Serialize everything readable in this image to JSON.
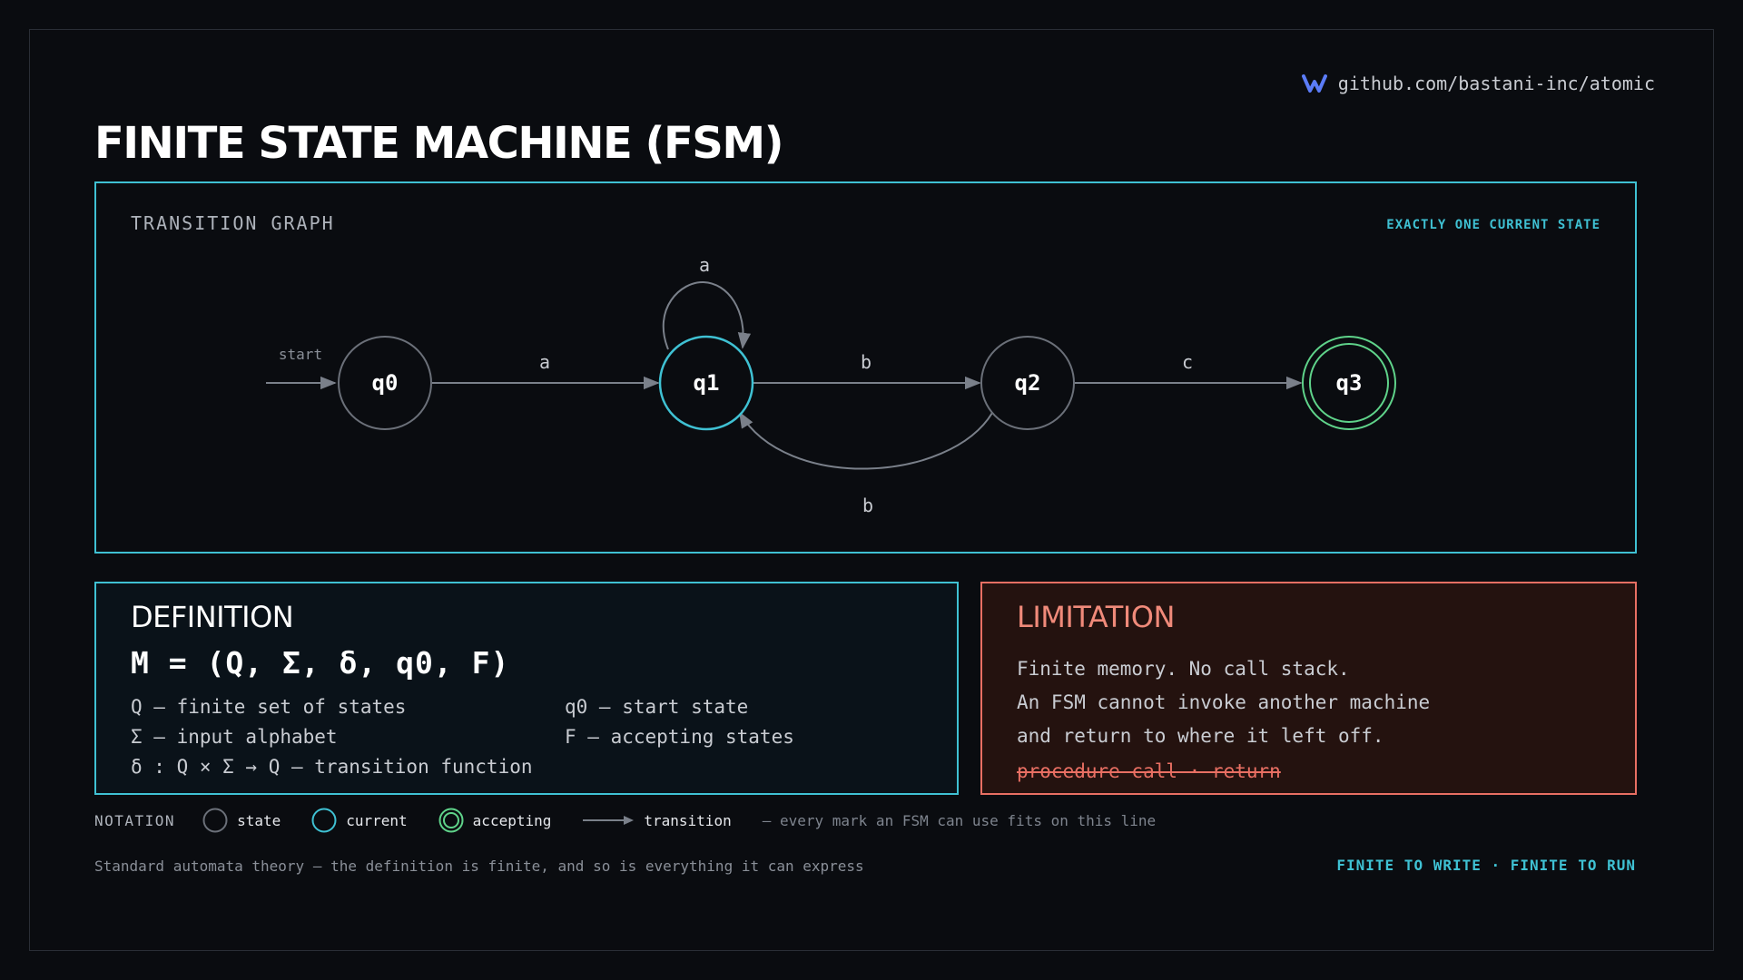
{
  "repo": {
    "text": "github.com/bastani-inc/atomic",
    "logo_icon": "atomic-v-logo-icon"
  },
  "title": "FINITE STATE MACHINE (FSM)",
  "graph": {
    "label": "TRANSITION GRAPH",
    "badge": "EXACTLY ONE CURRENT STATE",
    "start_label": "start",
    "states": [
      {
        "id": "q0",
        "label": "q0",
        "kind": "state"
      },
      {
        "id": "q1",
        "label": "q1",
        "kind": "current"
      },
      {
        "id": "q2",
        "label": "q2",
        "kind": "state"
      },
      {
        "id": "q3",
        "label": "q3",
        "kind": "accepting"
      }
    ],
    "transitions": [
      {
        "from": "q0",
        "to": "q1",
        "symbol": "a"
      },
      {
        "from": "q1",
        "to": "q1",
        "symbol": "a"
      },
      {
        "from": "q1",
        "to": "q2",
        "symbol": "b"
      },
      {
        "from": "q2",
        "to": "q1",
        "symbol": "b"
      },
      {
        "from": "q2",
        "to": "q3",
        "symbol": "c"
      }
    ]
  },
  "definition": {
    "heading": "DEFINITION",
    "formula": "M = (Q, Σ, δ, q0, F)",
    "items": [
      "Q — finite set of states",
      "Σ — input alphabet",
      "δ : Q × Σ → Q — transition function",
      "q0 — start state",
      "F — accepting states"
    ]
  },
  "limitation": {
    "heading": "LIMITATION",
    "lines": [
      "Finite memory. No call stack.",
      "An FSM cannot invoke another machine",
      "and return to where it left off."
    ],
    "struck": "procedure call · return"
  },
  "notation": {
    "label": "NOTATION",
    "state": "state",
    "current": "current",
    "accepting": "accepting",
    "transition": "transition",
    "note": "— every mark an FSM can use fits on this line"
  },
  "footer": {
    "left": "Standard automata theory — the definition is finite, and so is everything it can express",
    "right": "FINITE TO WRITE · FINITE TO RUN"
  },
  "colors": {
    "background": "#0a0c10",
    "accent_cyan": "#3fc1d3",
    "accepting_green": "#5fd38a",
    "limitation_red": "#e86f63",
    "state_stroke": "#6b7079",
    "edge": "#7a808a"
  }
}
